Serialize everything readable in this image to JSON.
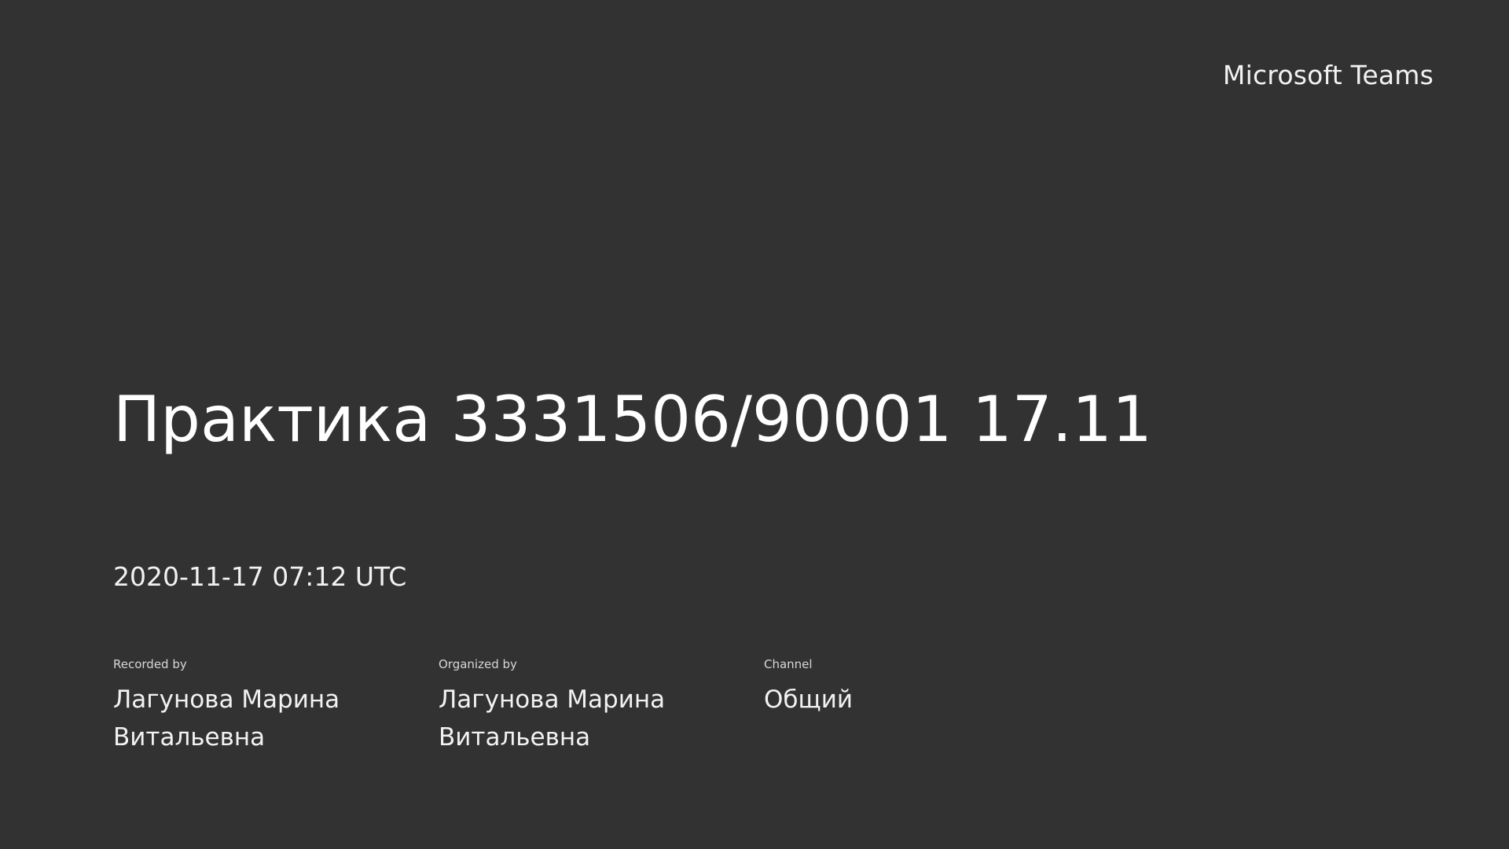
{
  "app": {
    "brand": "Microsoft Teams"
  },
  "meeting": {
    "title": "Практика 3331506/90001 17.11",
    "datetime": "2020-11-17 07:12 UTC"
  },
  "details": {
    "recorded_by": {
      "label": "Recorded by",
      "value_line1": "Лагунова Марина",
      "value_line2": "Витальевна"
    },
    "organized_by": {
      "label": "Organized by",
      "value_line1": "Лагунова Марина",
      "value_line2": "Витальевна"
    },
    "channel": {
      "label": "Channel",
      "value": "Общий"
    }
  },
  "colors": {
    "background": "#323232",
    "text": "#ffffff",
    "muted_text": "#d7d7d7"
  }
}
